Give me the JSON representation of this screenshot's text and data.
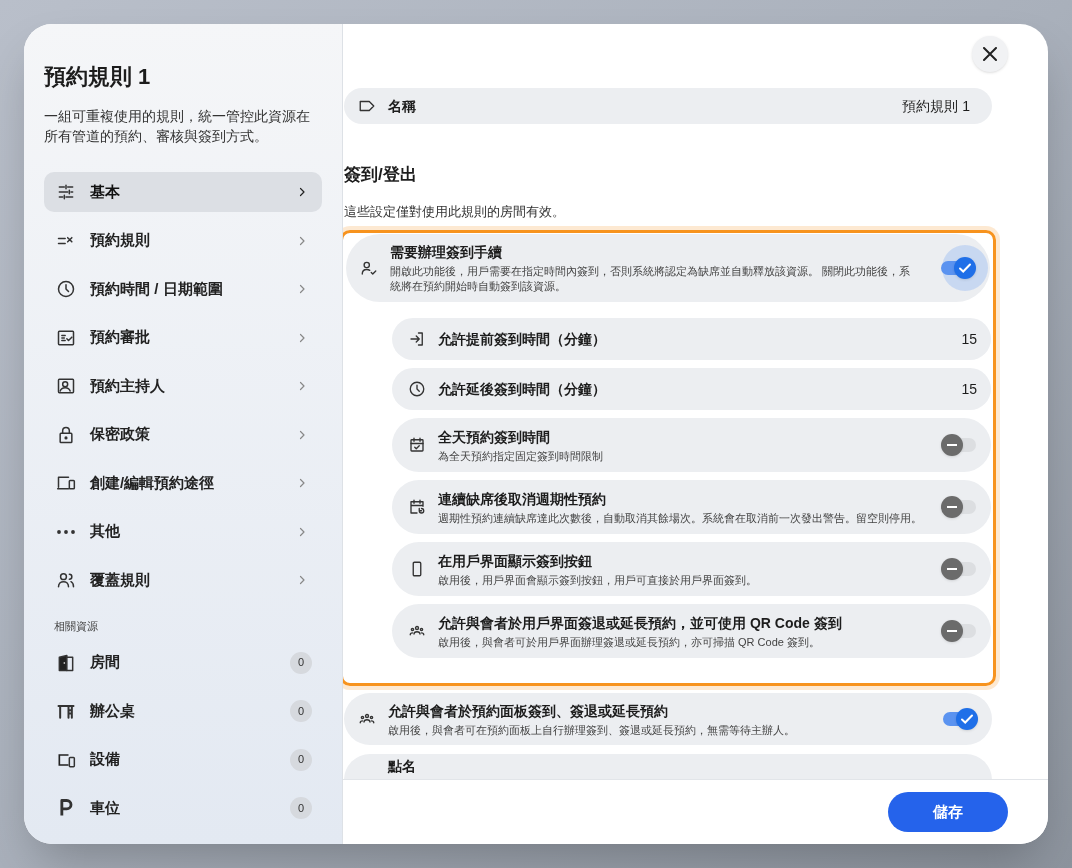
{
  "sidebar": {
    "title": "預約規則 1",
    "description": "一組可重複使用的規則，統一管控此資源在所有管道的預約、審核與簽到方式。",
    "nav_items": [
      {
        "label": "基本",
        "selected": true
      },
      {
        "label": "預約規則",
        "selected": false
      },
      {
        "label": "預約時間 / 日期範圍",
        "selected": false
      },
      {
        "label": "預約審批",
        "selected": false
      },
      {
        "label": "預約主持人",
        "selected": false
      },
      {
        "label": "保密政策",
        "selected": false
      },
      {
        "label": "創建/編輯預約途徑",
        "selected": false
      },
      {
        "label": "其他",
        "selected": false
      },
      {
        "label": "覆蓋規則",
        "selected": false
      }
    ],
    "resources_heading": "相關資源",
    "resources": [
      {
        "label": "房間",
        "count": "0"
      },
      {
        "label": "辦公桌",
        "count": "0"
      },
      {
        "label": "設備",
        "count": "0"
      },
      {
        "label": "車位",
        "count": "0"
      }
    ]
  },
  "name_field": {
    "label": "名稱",
    "value": "預約規則 1"
  },
  "section": {
    "title": "簽到/登出",
    "subtitle": "這些設定僅對使用此規則的房間有效。"
  },
  "check_in": {
    "title": "需要辦理簽到手續",
    "description": "開啟此功能後，用戶需要在指定時間內簽到，否則系統將認定為缺席並自動釋放該資源。 關閉此功能後，系統將在預約開始時自動簽到該資源。",
    "on": true,
    "focused": true,
    "options": [
      {
        "kind": "number",
        "title": "允許提前簽到時間（分鐘）",
        "value": "15"
      },
      {
        "kind": "number",
        "title": "允許延後簽到時間（分鐘）",
        "value": "15"
      },
      {
        "kind": "toggle",
        "title": "全天預約簽到時間",
        "description": "為全天預約指定固定簽到時間限制",
        "on": false
      },
      {
        "kind": "toggle",
        "title": "連續缺席後取消週期性預約",
        "description": "週期性預約連續缺席達此次數後，自動取消其餘場次。系統會在取消前一次發出警告。留空則停用。",
        "on": false
      },
      {
        "kind": "toggle",
        "title": "在用戶界面顯示簽到按鈕",
        "description": "啟用後，用戶界面會顯示簽到按鈕，用戶可直接於用戶界面簽到。",
        "on": false
      },
      {
        "kind": "toggle",
        "title": "允許與會者於用戶界面簽退或延長預約，並可使用 QR Code 簽到",
        "description": "啟用後，與會者可於用戶界面辦理簽退或延長預約，亦可掃描 QR Code 簽到。",
        "on": false
      }
    ]
  },
  "panel_option": {
    "title": "允許與會者於預約面板簽到、簽退或延長預約",
    "description": "啟用後，與會者可在預約面板上自行辦理簽到、簽退或延長預約，無需等待主辦人。",
    "on": true,
    "focused": false
  },
  "roll_call": {
    "title": "點名"
  },
  "save_button": "儲存"
}
